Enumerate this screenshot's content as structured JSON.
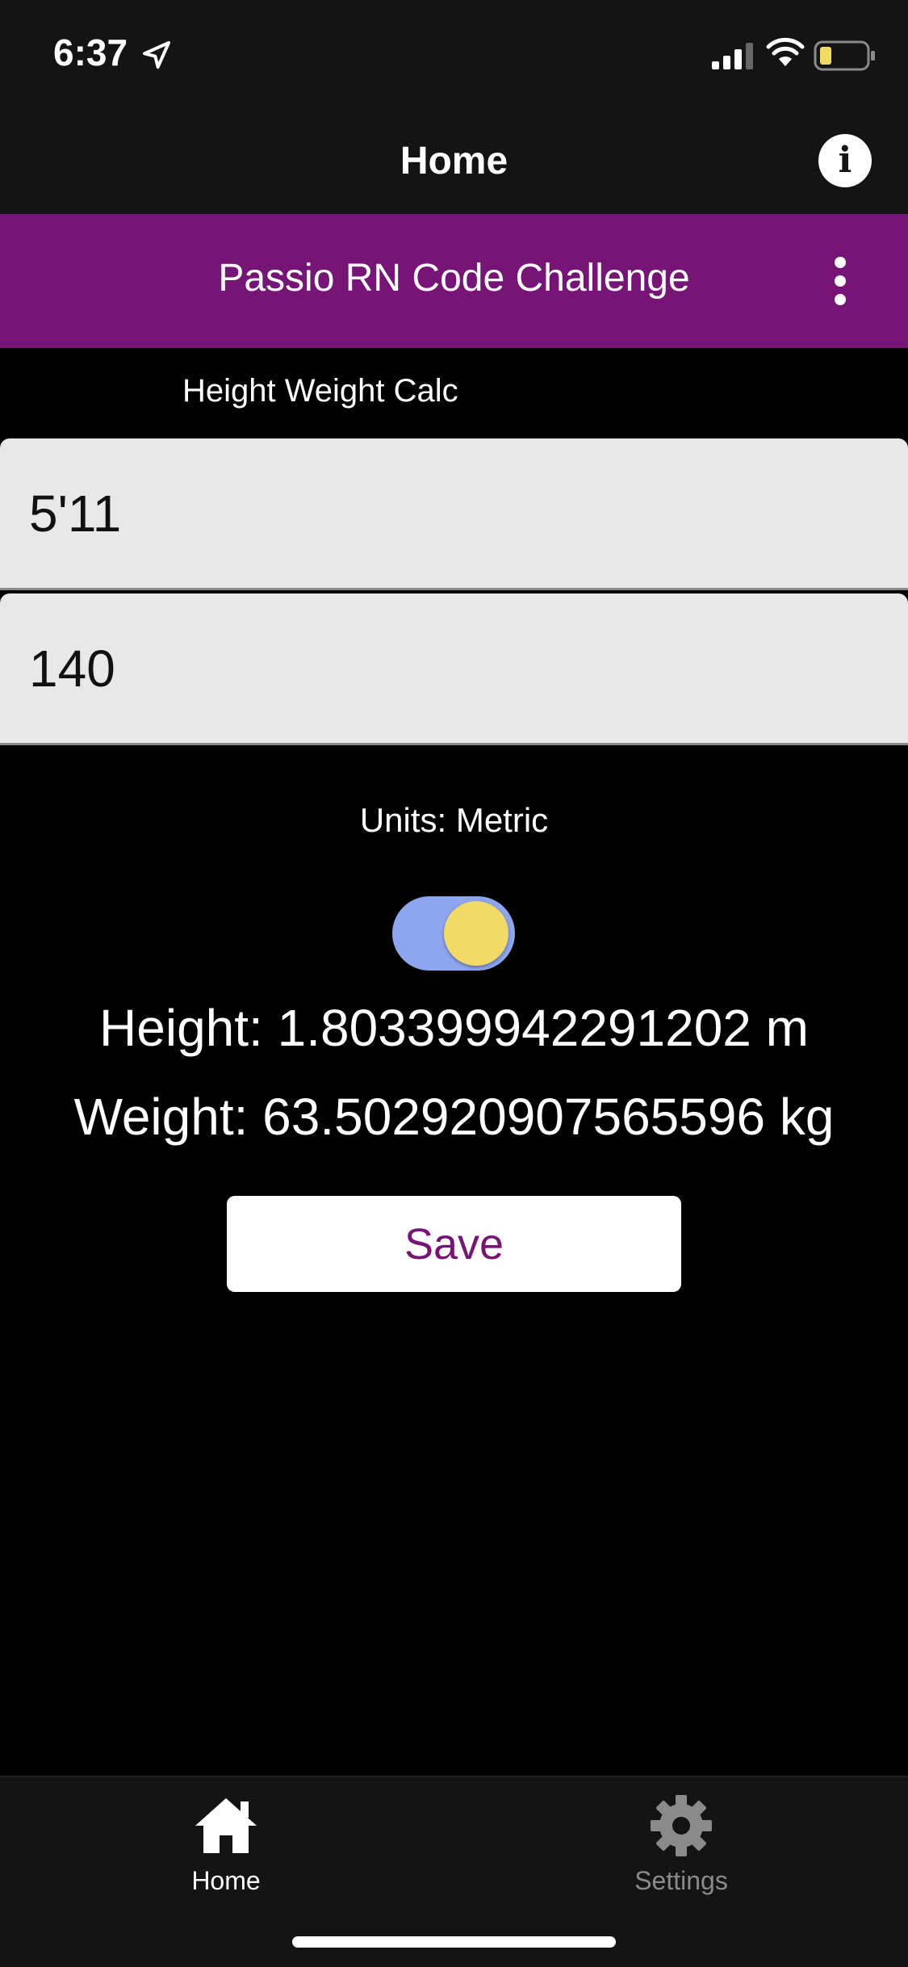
{
  "status_bar": {
    "time": "6:37",
    "icons": [
      "location-arrow-icon",
      "cellular-signal-icon",
      "wifi-icon",
      "battery-low-icon"
    ]
  },
  "nav": {
    "title": "Home",
    "info_icon": "info-icon"
  },
  "app_bar": {
    "title": "Passio RN Code Challenge",
    "menu_icon": "more-vertical-icon",
    "color": "#761575"
  },
  "main": {
    "section_label": "Height Weight Calc",
    "height_input": {
      "value": "5'11",
      "placeholder": ""
    },
    "weight_input": {
      "value": "140",
      "placeholder": ""
    },
    "units_label": "Units: Metric",
    "units_toggle": {
      "on": true,
      "track_color": "#8ea5ef",
      "knob_color": "#f1da66"
    },
    "height_result": "Height: 1.803399942291202 m",
    "weight_result": "Weight: 63.502920907565596 kg",
    "save_label": "Save"
  },
  "tab_bar": {
    "tabs": [
      {
        "label": "Home",
        "icon": "home-icon",
        "active": true
      },
      {
        "label": "Settings",
        "icon": "gear-icon",
        "active": false
      }
    ]
  }
}
